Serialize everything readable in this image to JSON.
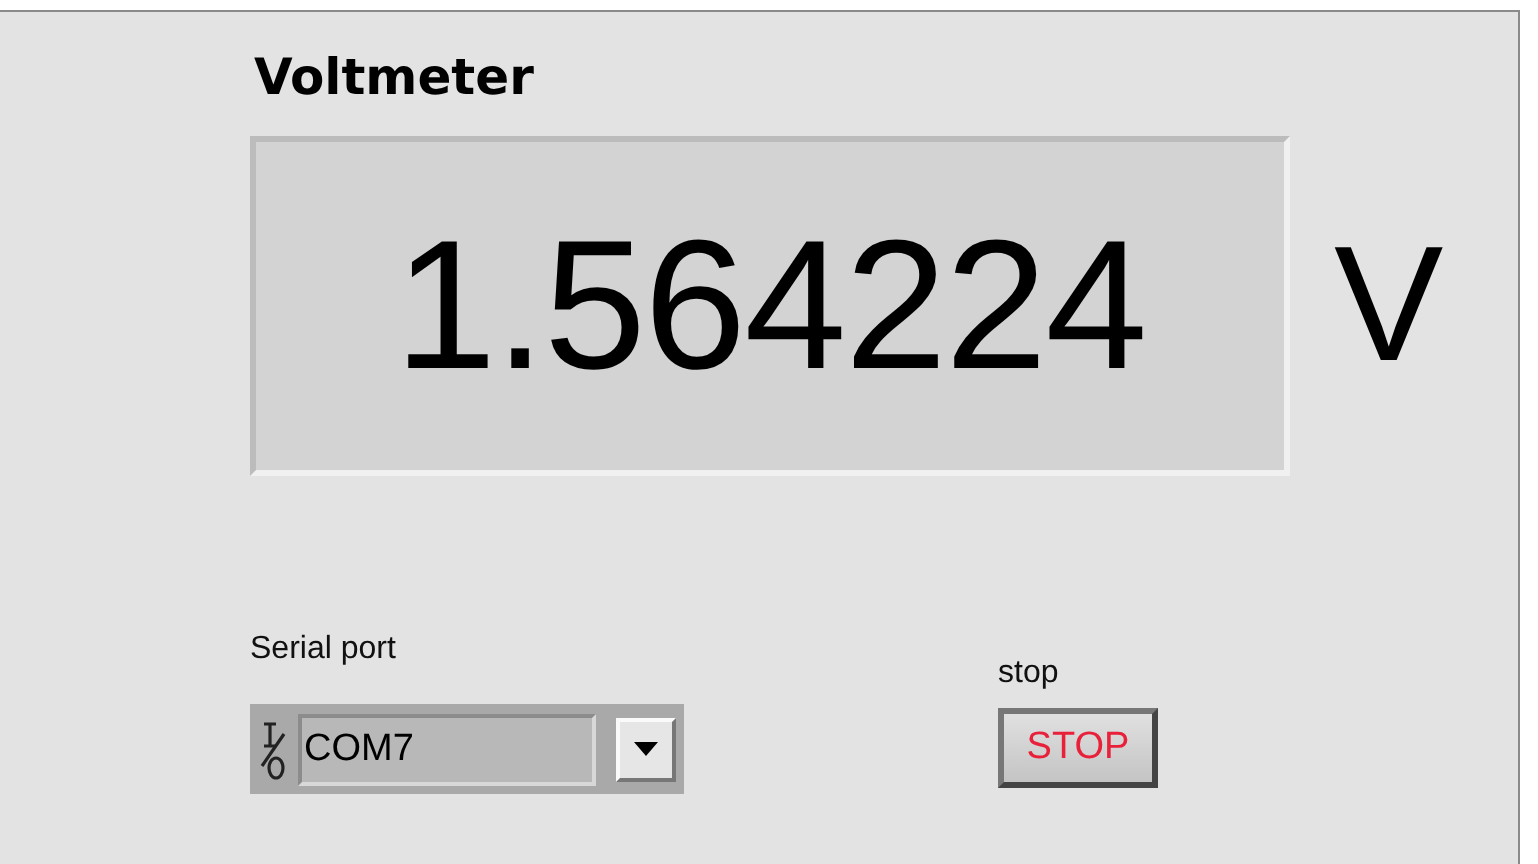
{
  "voltmeter": {
    "label": "Voltmeter",
    "value": "1.564224",
    "unit": "V"
  },
  "serial_port": {
    "label": "Serial port",
    "value": "COM7"
  },
  "stop": {
    "label": "stop",
    "button": "STOP"
  }
}
